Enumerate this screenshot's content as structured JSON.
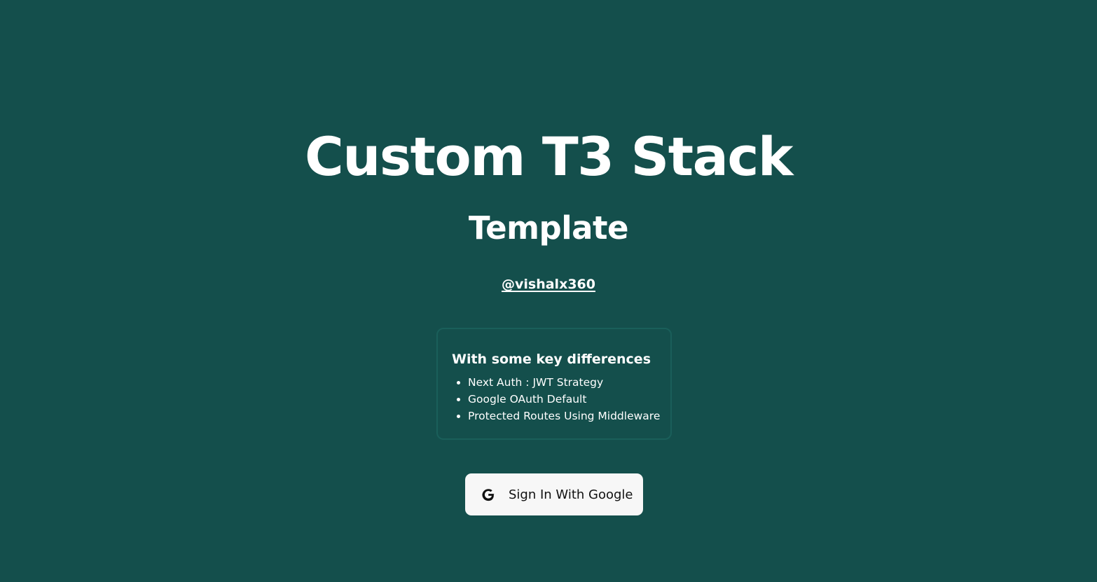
{
  "header": {
    "title": "Custom T3 Stack",
    "subtitle": "Template",
    "handle": "@vishalx360"
  },
  "features": {
    "heading": "With some key differences",
    "items": [
      "Next Auth : JWT Strategy",
      "Google OAuth Default",
      "Protected Routes Using Middleware"
    ]
  },
  "signin": {
    "label": "Sign In With Google",
    "icon": "google-icon"
  },
  "colors": {
    "background": "#144f4c",
    "card_border": "#1a5f5a",
    "button_bg": "#f7f7f7",
    "text": "#ffffff"
  }
}
